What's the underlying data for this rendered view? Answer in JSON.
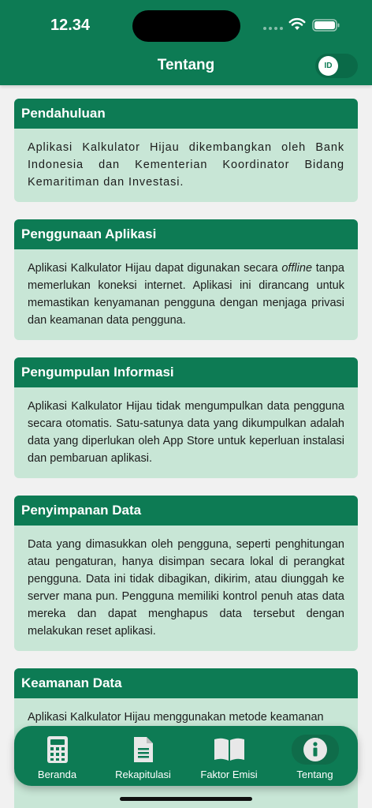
{
  "status_bar": {
    "time": "12.34"
  },
  "header": {
    "title": "Tentang",
    "lang_toggle": "ID"
  },
  "cards": [
    {
      "heading": "Pendahuluan",
      "body": "Aplikasi Kalkulator Hijau dikembangkan oleh Bank Indonesia dan Kementerian Koordinator Bidang Kemaritiman dan Investasi."
    },
    {
      "heading": "Penggunaan Aplikasi",
      "body_pre": "Aplikasi Kalkulator Hijau dapat digunakan secara ",
      "body_em": "offline",
      "body_post": " tanpa memerlukan koneksi internet. Aplikasi ini dirancang untuk memastikan kenyamanan pengguna dengan menjaga privasi dan keamanan data pengguna."
    },
    {
      "heading": "Pengumpulan Informasi",
      "body": "Aplikasi Kalkulator Hijau tidak mengumpulkan data pengguna secara otomatis. Satu-satunya data yang dikumpulkan adalah data yang diperlukan oleh App Store untuk keperluan instalasi dan pembaruan aplikasi."
    },
    {
      "heading": "Penyimpanan Data",
      "body": "Data yang dimasukkan oleh pengguna, seperti penghitungan atau pengaturan, hanya disimpan secara lokal di perangkat pengguna. Data ini tidak dibagikan, dikirim, atau diunggah ke server mana pun. Pengguna memiliki kontrol penuh atas data mereka dan dapat menghapus data tersebut dengan melakukan reset aplikasi."
    },
    {
      "heading": "Keamanan Data",
      "body": "Aplikasi Kalkulator Hijau menggunakan metode keamanan"
    }
  ],
  "nav": {
    "items": [
      {
        "label": "Beranda",
        "icon": "calculator-icon"
      },
      {
        "label": "Rekapitulasi",
        "icon": "document-icon"
      },
      {
        "label": "Faktor Emisi",
        "icon": "book-icon"
      },
      {
        "label": "Tentang",
        "icon": "info-icon",
        "active": true
      }
    ]
  },
  "colors": {
    "primary": "#0d7b54",
    "card_bg": "#c8e6d6",
    "page_bg": "#f1f1f1"
  }
}
